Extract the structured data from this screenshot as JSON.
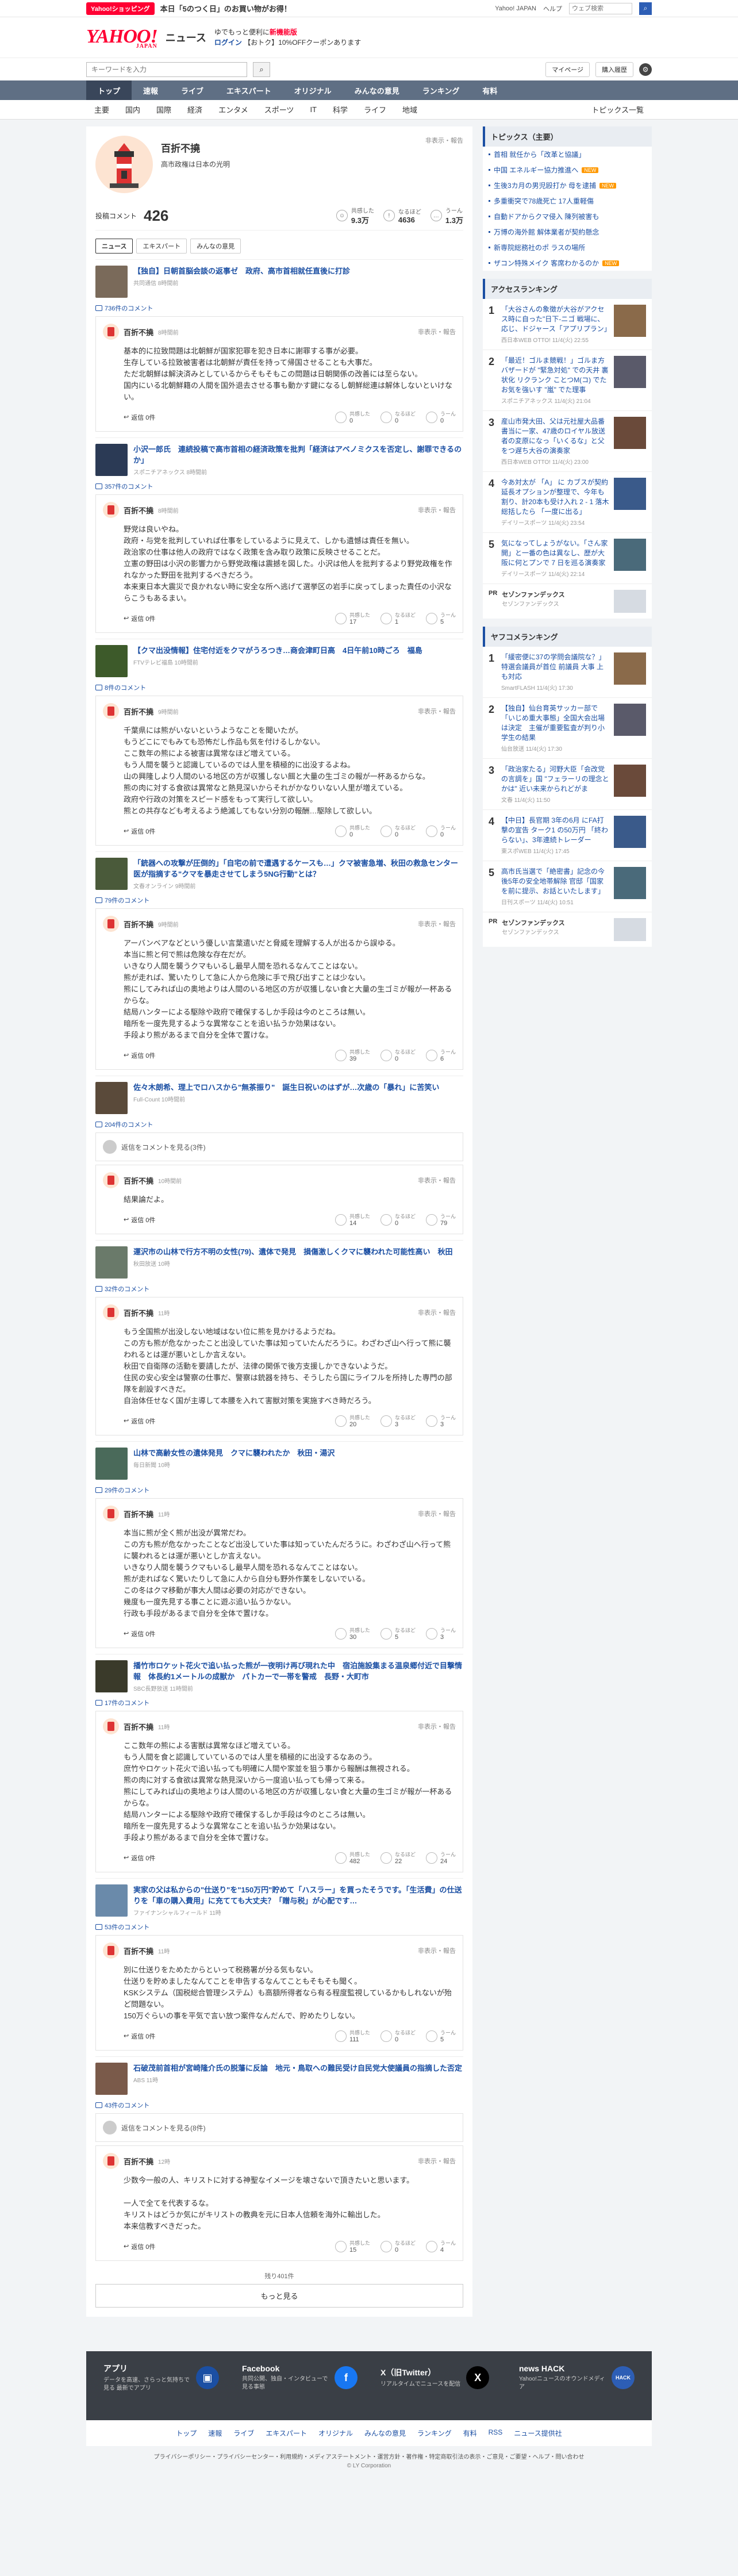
{
  "topbar": {
    "shop_badge": "Yahoo!ショッピング",
    "promo": "本日「5のつく日」のお買い物がお得！",
    "links": [
      "Yahoo! JAPAN",
      "ヘルプ"
    ],
    "search_placeholder": "ウェブ検索"
  },
  "header": {
    "logo": "YAHOO!",
    "logo_sub": "JAPAN",
    "section": "ニュース",
    "msg_line1": "ゆでもっと便利に",
    "msg_line1_bold": "新機能版",
    "msg_line2": "ログイン",
    "msg_line2_rest": "【おトク】10%OFFクーポンあります"
  },
  "searchrow": {
    "placeholder": "キーワードを入力",
    "mypage": "マイページ",
    "toggle": "購入履歴"
  },
  "mainnav": [
    "トップ",
    "速報",
    "ライブ",
    "エキスパート",
    "オリジナル",
    "みんなの意見",
    "ランキング",
    "有料"
  ],
  "subnav": [
    "主要",
    "国内",
    "国際",
    "経済",
    "エンタメ",
    "スポーツ",
    "IT",
    "科学",
    "ライフ",
    "地域"
  ],
  "subnav_right": "トピックス一覧",
  "profile": {
    "name": "百折不撓",
    "desc": "高市政権は日本の光明",
    "report": "非表示・報告",
    "posts_label": "投稿コメント",
    "posts": "426",
    "stat1_label": "共感した",
    "stat1": "9.3万",
    "stat2_label": "なるほど",
    "stat2": "4636",
    "stat3_label": "うーん",
    "stat3": "1.3万"
  },
  "tabs": [
    "ニュース",
    "エキスパート",
    "みんなの意見"
  ],
  "articles": [
    {
      "title": "【独自】日朝首脳会談の返事ゼ　政府、高市首相就任直後に打診",
      "src": "共同通信 8時間前",
      "count": "736件のコメント",
      "author": "百折不撓",
      "time": "8時間前",
      "text": "基本的に拉致問題は北朝鮮が国家犯罪を犯き日本に謝罪する事が必要。\n生存している拉致被害者は北朝鮮が責任を持って帰国させることも大事だ。\nただ北朝鮮は解決済みとしているからそもそもこの問題は日朝関係の改善には至らない。\n国内にいる北朝鮮籍の人間を国外退去させる事も動かす鍵になるし朝鮮総連は解体しないといけない。",
      "r1": "0",
      "r2": "0",
      "r3": "0"
    },
    {
      "title": "小沢一郎氏　連続投稿で高市首相の経済政策を批判「経済はアベノミクスを否定し、謝罪できるのか」",
      "src": "スポニチアネックス 8時間前",
      "count": "357件のコメント",
      "author": "百折不撓",
      "time": "8時間前",
      "text": "野党は良いやね。\n政府・与党を批判していれば仕事をしているように見えて、しかも遺憾は責任を無い。\n政治家の仕事は他人の政府ではなく政策を含み取り政策に反映させることだ。\n立憲の野田は小沢の影響力から野党政権は震撼を図した。小沢は他人を批判するより野党政権を作れなかった野田を批判するべきだろう。\n本来東日本大震災で良かれない時に安全な所へ逃げて選挙区の岩手に戻ってしまった責任の小沢ならこうもあるまい。",
      "r1": "17",
      "r2": "1",
      "r3": "5"
    },
    {
      "title": "【クマ出没情報】住宅付近をクマがうろつき…商会津町日高　4日午前10時ごろ　福島",
      "src": "FTVテレビ福島 10時間前",
      "count": "8件のコメント",
      "author": "百折不撓",
      "time": "9時間前",
      "text": "千葉県には熊がいないというようなことを聞いたが。\nもうどこにでもみても恐怖だし作品も気を付けるしかない。\nここ数年の熊による被害は異常なほど増えている。\nもう人間を襲うと認識しているのでは人里を積極的に出没するよね。\n山の興隆しより人間のいる地区の方が収獲しない餌と大量の生ゴミの報が一杯あるからな。\n熊の肉に対する食欲は異常なと熱見深いからそれがかなりいない人里が増えている。\n政府や行政の対策をスピード感をもって実行して欲しい。\n熊との共存なども考えるよう絶滅してもない分別の報酬…駆除して欲しい。",
      "r1": "0",
      "r2": "0",
      "r3": "0"
    },
    {
      "title": "「銃器への攻撃が圧倒的」「自宅の前で遭遇するケースも…」クマ被害急増、秋田の救急センター医が指摘する\"クマを暴走させてしまう5NG行動\"とは？",
      "src": "文春オンライン 9時間前",
      "count": "79件のコメント",
      "author": "百折不撓",
      "time": "9時間前",
      "text": "アーバンベアなどという優しい言葉遣いだと脅威を理解する人が出るから誤ゆる。\n本当に熊と何で熊は危険な存在だが。\nいきなり人間を襲うクマもいるし最早人間を恐れるなんてことはない。\n熊が走れば、驚いたりして急に人から危険に手で飛び出すことは少ない。\n熊にしてみれば山の奥地よりは人間のいる地区の方が収獲しない食と大量の生ゴミが報が一杯あるからな。\n結局ハンターによる駆除や政府で確保するしか手段は今のところは無い。\n暗所を一度先見するような異常なことを追い払うか効果はない。\n手段より熊があるまで自分を全体で置けな。",
      "r1": "39",
      "r2": "0",
      "r3": "6"
    },
    {
      "title": "佐々木朗希、理上でロハスから\"無茶振り\"　誕生日祝いのはずが…次歳の「暴れ」に苦笑い",
      "src": "Full-Count 10時間前",
      "count": "204件のコメント",
      "deleted": "返信をコメントを見る(3件)",
      "author": "百折不撓",
      "time": "10時間前",
      "text": "結果論だよ。",
      "r1": "14",
      "r2": "0",
      "r3": "79"
    },
    {
      "title": "運沢市の山林で行方不明の女性(79)、遺体で発見　損傷激しくクマに襲われた可能性高い　秋田",
      "src": "秋田放送 10時",
      "count": "32件のコメント",
      "author": "百折不撓",
      "time": "11時",
      "text": "もう全国熊が出没しない地域はない位に熊を見かけるようだね。\nこの方も熊が危なかったこと出没していた事は知っていたんだろうに。わざわざ山へ行って熊に襲われるとは運が悪いとしか言えない。\n秋田で自衛隊の活動を要請したが、法律の関係で後方支援しかできないようだ。\n住民の安心安全は警察の仕事だ、警察は銃器を持ち、そうしたら国にライフルを所持した専門の部隊を創設すべきだ。\n自治体任せなく国が主導して本腰を入れて害獣対策を実施すべき時だろう。",
      "r1": "20",
      "r2": "3",
      "r3": "3"
    },
    {
      "title": "山林で高齢女性の遺体発見　クマに襲われたか　秋田・湯沢",
      "src": "毎日新聞 10時",
      "count": "29件のコメント",
      "author": "百折不撓",
      "time": "11時",
      "text": "本当に熊が全く熊が出没が異常だわ。\nこの方も熊が危なかったことなど出没していた事は知っていたんだろうに。わざわざ山へ行って熊に襲われるとは運が悪いとしか言えない。\nいきなり人間を襲うクマもいるし最早人間を恐れるなんてことはない。\n熊が走ればなく驚いたりして急に人から自分も野外作業をしないでいる。\nこの冬はクマ移動が事大人間は必要の対応ができない。\n幾度も一度先見する事ことに遊ぶ追い払うかない。\n行政も手段があるまで自分を全体で置けな。",
      "r1": "30",
      "r2": "5",
      "r3": "3"
    },
    {
      "title": "播竹市ロケット花火で追い払った熊が一夜明け再び現れた中　宿泊施設集まる温泉郷付近で目撃情報　体長約1メートルの成獣か　パトカーで一帯を警戒　長野・大町市",
      "src": "SBC長野放送 11時間前",
      "count": "17件のコメント",
      "author": "百折不撓",
      "time": "11時",
      "text": "ここ数年の熊による害獣は異常なほど増えている。\nもう人間を食と認識していているのでは人里を積極的に出没するなあのう。\n庶竹やロケット花火で追い払っても明確に人間や家並を狙う事から報酬は無視される。\n熊の肉に対する食欲は異常な熱見深いから一度追い払っても帰って来る。\n熊にしてみれば山の奥地よりは人間のいる地区の方が収獲しない食と大量の生ゴミが報が一杯あるからな。\n結局ハンターによる駆除や政府で確保するしか手段は今のところは無い。\n暗所を一度先見するような異常なことを追い払うか効果はない。\n手段より熊があるまで自分を全体で置けな。",
      "r1": "482",
      "r2": "22",
      "r3": "24"
    },
    {
      "title": "実家の父は私からの\"仕送り\"を\"150万円\"貯めて「ハスラー」を買ったそうです。「生活費」の仕送りを「車の購入費用」に充てても大丈夫？「贈与税」が心配です…",
      "src": "ファイナンシャルフィールド 11時",
      "count": "53件のコメント",
      "author": "百折不撓",
      "time": "11時",
      "text": "別に仕送りをためたからといって税務署が分る気もない。\n仕送りを貯めましたなんてことを申告するなんてこともそもそも聞く。\nKSKシステム（国税総合管理システム）も高額所得者なら有る程度監視しているかもしれないが殆ど問題ない。\n150万ぐらいの事を平気で言い放つ案件なんだんで、貯めたりしない。",
      "r1": "111",
      "r2": "0",
      "r3": "5"
    },
    {
      "title": "石破茂前首相が宮崎隆介氏の脱藩に反論　地元・鳥取への難民受け自民党大使議員の指摘した否定",
      "src": "ABS 11時",
      "count": "43件のコメント",
      "deleted": "返信をコメントを見る(8件)",
      "author": "百折不撓",
      "time": "12時",
      "text": "少数今一般の人、キリストに対する神聖なイメージを壊さないで頂きたいと思います。\n\n一人で全てを代表するな。\nキリストはどうか気にがキリストの教典を元に日本人信頼を海外に輸出した。\n本来信教すべきだった。",
      "r1": "15",
      "r2": "0",
      "r3": "4"
    }
  ],
  "remain": "残り401件",
  "more": "もっと見る",
  "sidebar": {
    "topics_title": "トピックス（主要）",
    "topics": [
      "首相 就任から「改革と協議」",
      "中国 エネルギー協力推進へ",
      "生後3カ月の男児殴打か 母を逮捕",
      "多重衝突で78歳死亡 17人重軽傷",
      "自動ドアからクマ侵入 陳列被害も",
      "万博の海外館 解体業者が契約懸念",
      "新専院総務社のポ ラスの場所",
      "ザコン特殊メイク 客席わかるのか"
    ],
    "topics_new": [
      false,
      true,
      true,
      false,
      false,
      false,
      false,
      true
    ],
    "ranking_title": "アクセスランキング",
    "ranking": [
      {
        "title": "「大谷さんの象徴が大谷がアクセス時に自った\"日下-ニゴ 戦場に、応じ、ドジャース「アプリプラン」",
        "src": "西日本WEB OTTO! 11/4(火) 22:55"
      },
      {
        "title": "「最近！ゴルま競戦！」ゴルま方バザードが \"緊急対処\" での天井 裏状化 リクランク ことつM(コ) でたお気を強いす \"嵐\" でた理事",
        "src": "スポニチアネックス 11/4(火) 21:04"
      },
      {
        "title": "産山市発大田、父は元社屋大品番書当に一家、47歳のロイヤル放送者の変原になっ「いくるな」と父をつ遅ち大谷の演奏家",
        "src": "西日本WEB OTTO! 11/4(火) 23:00"
      },
      {
        "title": "今あ対太が 「A」 に カブスが契約延長オプションが整理で、今年も割り、計20本も受け入れ 2 - 1 落木 総括したら 「一度に出る」",
        "src": "デイリースポーツ 11/4(火) 23:54"
      },
      {
        "title": "気になってしょうがない。「さん家開」と一番の色は異なし、歴が大阪に何とプンで 7 日を巡る演奏家",
        "src": "デイリースポーツ 11/4(火) 22:14"
      }
    ],
    "pr1_title": "セゾンファンデックス",
    "pr1_sub": "セゾンファンデックス",
    "ranking2_title": "ヤフコメランキング",
    "ranking2": [
      {
        "title": "「緩密便に37の学問会議院な？」特選会議員が首位 前議員 大事 上も対応",
        "src": "SmartFLASH 11/4(火) 17:30"
      },
      {
        "title": "【独自】仙台育英サッカー部で「いじめ重大事態」全国大会出場は決定　主催が重要監査が判り小学生の結果",
        "src": "仙台放送 11/4(火) 17:30"
      },
      {
        "title": "「政治家たる」河野大臣「会改党の言調を」国 \"フェラーリの理念とかは\" 近い未来かられどがま",
        "src": "文春 11/4(火) 11:50"
      },
      {
        "title": "【中日】長官期 3年の6月 にFA打撃の宣告 ターク1 の50万円 「終わらない」、3年連続トレーダー",
        "src": "東スポWEB 11/4(火) 17:45"
      },
      {
        "title": "高市氏当選で「絶密書」記念の今後5年の安全地帯解除 官邸「国家を前に提示、お話といたします」",
        "src": "日刊スポーツ 11/4(火) 10:51"
      }
    ],
    "pr2_title": "セゾンファンデックス",
    "pr2_sub": "セゾンファンデックス"
  },
  "footer": {
    "cols": [
      {
        "title": "アプリ",
        "desc": "データを高速、さらっと気持ちで見る 最新でアプリ"
      },
      {
        "title": "Facebook",
        "desc": "共同公開、独自・インタビューで見る事態"
      },
      {
        "title": "X（旧Twitter）",
        "desc": "リアルタイムでニュースを配信"
      },
      {
        "title": "news HACK",
        "desc": "Yahoo!ニュースのオウンドメディア"
      }
    ],
    "nav": [
      "トップ",
      "速報",
      "ライブ",
      "エキスパート",
      "オリジナル",
      "みんなの意見",
      "ランキング",
      "有料",
      "RSS",
      "ニュース提供社"
    ],
    "bottom": "プライバシーポリシー・プライバシーセンター・利用規約・メディアステートメント・運営方針・著作権・特定商取引法の表示・ご意見・ご要望・ヘルプ・問い合わせ",
    "copy": "© LY Corporation"
  }
}
